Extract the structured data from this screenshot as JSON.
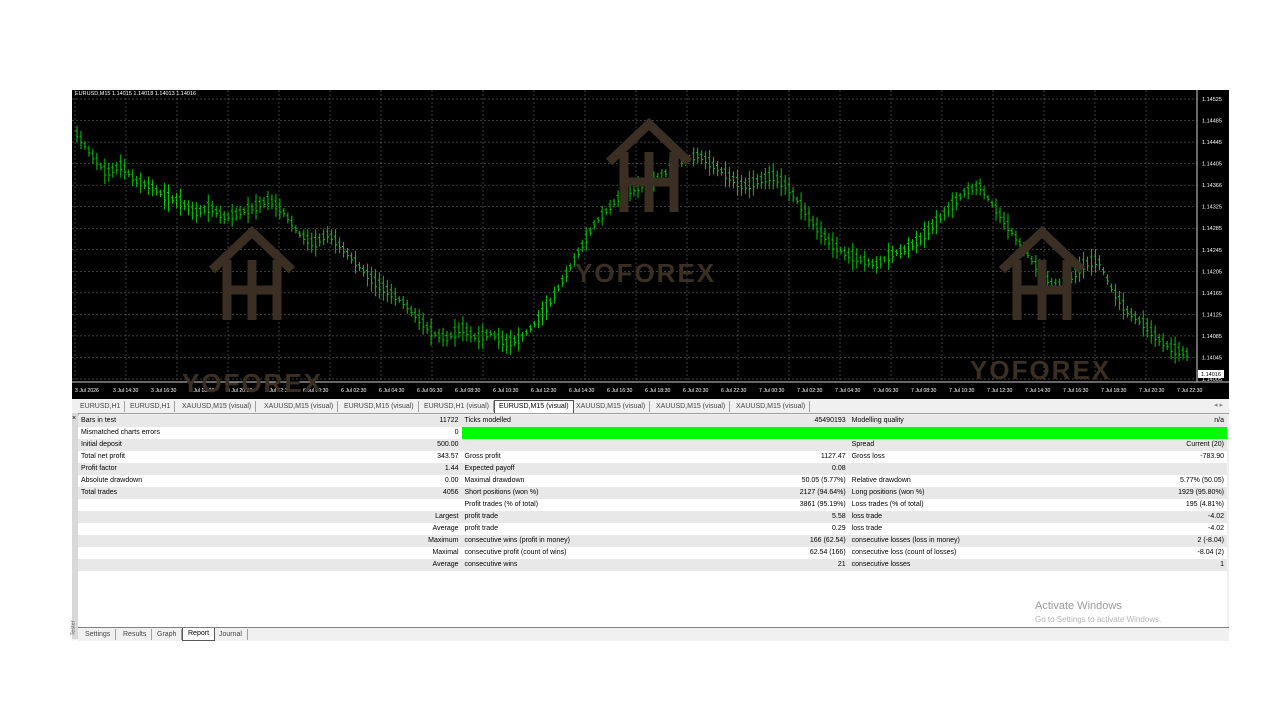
{
  "chart": {
    "header": "EURUSD,M15  1.14015 1.14018 1.14013 1.14016",
    "price_labels": [
      "1.14525",
      "1.14485",
      "1.14445",
      "1.14405",
      "1.14366",
      "1.14325",
      "1.14285",
      "1.14245",
      "1.14205",
      "1.14165",
      "1.14125",
      "1.14085",
      "1.14045",
      "1.14005"
    ],
    "current_price": "1.14016",
    "time_labels": [
      "3 Jul 2026",
      "3 Jul 14:30",
      "3 Jul 16:30",
      "3 Jul 18:30",
      "3 Jul 20:30",
      "3 Jul 22:30",
      "6 Jul 00:30",
      "6 Jul 02:30",
      "6 Jul 04:30",
      "6 Jul 06:30",
      "6 Jul 08:30",
      "6 Jul 10:30",
      "6 Jul 12:30",
      "6 Jul 14:30",
      "6 Jul 16:30",
      "6 Jul 18:30",
      "6 Jul 20:30",
      "6 Jul 22:30",
      "7 Jul 00:30",
      "7 Jul 02:30",
      "7 Jul 04:30",
      "7 Jul 06:30",
      "7 Jul 08:30",
      "7 Jul 10:30",
      "7 Jul 12:30",
      "7 Jul 14:30",
      "7 Jul 16:30",
      "7 Jul 18:30",
      "7 Jul 20:30",
      "7 Jul 22:30"
    ],
    "watermark": "YOFOREX",
    "bar_color": "#00c800",
    "price_path": [
      0.9,
      0.82,
      0.75,
      0.78,
      0.72,
      0.7,
      0.66,
      0.64,
      0.6,
      0.62,
      0.58,
      0.6,
      0.62,
      0.65,
      0.6,
      0.52,
      0.48,
      0.52,
      0.46,
      0.4,
      0.34,
      0.3,
      0.26,
      0.2,
      0.14,
      0.12,
      0.16,
      0.12,
      0.14,
      0.1,
      0.12,
      0.18,
      0.26,
      0.36,
      0.46,
      0.56,
      0.62,
      0.68,
      0.7,
      0.72,
      0.76,
      0.8,
      0.82,
      0.78,
      0.74,
      0.7,
      0.72,
      0.74,
      0.7,
      0.62,
      0.54,
      0.48,
      0.44,
      0.42,
      0.4,
      0.44,
      0.46,
      0.5,
      0.56,
      0.62,
      0.68,
      0.7,
      0.62,
      0.54,
      0.46,
      0.38,
      0.32,
      0.34,
      0.4,
      0.42,
      0.3,
      0.22,
      0.18,
      0.12,
      0.08,
      0.06
    ]
  },
  "chart_tabs": [
    "EURUSD,H1",
    "EURUSD,H1",
    "XAUUSD,M15 (visual)",
    "XAUUSD,M15 (visual)",
    "EURUSD,M15 (visual)",
    "EURUSD,H1 (visual)",
    "EURUSD,M15 (visual)",
    "XAUUSD,M15 (visual)",
    "XAUUSD,M15 (visual)",
    "XAUUSD,M15 (visual)"
  ],
  "active_tab_index": 6,
  "report": {
    "bars_in_test_label": "Bars in test",
    "bars_in_test": "11722",
    "ticks_modelled_label": "Ticks modelled",
    "ticks_modelled": "45490193",
    "modelling_quality_label": "Modelling quality",
    "modelling_quality": "n/a",
    "mismatched_label": "Mismatched charts errors",
    "mismatched": "0",
    "quality_bar_color": "#00ff00",
    "initial_deposit_label": "Initial deposit",
    "initial_deposit": "500.00",
    "spread_label": "Spread",
    "spread": "Current (20)",
    "net_profit_label": "Total net profit",
    "net_profit": "343.57",
    "gross_profit_label": "Gross profit",
    "gross_profit": "1127.47",
    "gross_loss_label": "Gross loss",
    "gross_loss": "-783.90",
    "profit_factor_label": "Profit factor",
    "profit_factor": "1.44",
    "expected_payoff_label": "Expected payoff",
    "expected_payoff": "0.08",
    "abs_drawdown_label": "Absolute drawdown",
    "abs_drawdown": "0.00",
    "max_drawdown_label": "Maximal drawdown",
    "max_drawdown": "50.05 (5.77%)",
    "rel_drawdown_label": "Relative drawdown",
    "rel_drawdown": "5.77% (50.05)",
    "total_trades_label": "Total trades",
    "total_trades": "4056",
    "short_label": "Short positions (won %)",
    "short": "2127 (94.64%)",
    "long_label": "Long positions (won %)",
    "long": "1929 (95.80%)",
    "profit_trades_label": "Profit trades (% of total)",
    "profit_trades": "3861 (95.19%)",
    "loss_trades_label": "Loss trades (% of total)",
    "loss_trades": "195 (4.81%)",
    "largest_label": "Largest",
    "largest_profit_label": "profit trade",
    "largest_profit": "5.58",
    "largest_loss_label": "loss trade",
    "largest_loss": "-4.02",
    "average_label": "Average",
    "average_profit_label": "profit trade",
    "average_profit": "0.29",
    "average_loss_label": "loss trade",
    "average_loss": "-4.02",
    "maximum_label": "Maximum",
    "max_cons_wins_label": "consecutive wins (profit in money)",
    "max_cons_wins": "166 (62.54)",
    "max_cons_losses_label": "consecutive losses (loss in money)",
    "max_cons_losses": "2 (-8.04)",
    "maximal_label": "Maximal",
    "maximal_cons_profit_label": "consecutive profit (count of wins)",
    "maximal_cons_profit": "62.54 (166)",
    "maximal_cons_loss_label": "consecutive loss (count of losses)",
    "maximal_cons_loss": "-8.04 (2)",
    "avg_label": "Average",
    "avg_cons_wins_label": "consecutive wins",
    "avg_cons_wins": "21",
    "avg_cons_losses_label": "consecutive losses",
    "avg_cons_losses": "1"
  },
  "bottom_tabs": [
    "Settings",
    "Results",
    "Graph",
    "Report",
    "Journal"
  ],
  "bottom_active_index": 3,
  "tester_label": "Tester",
  "close_glyph": "×",
  "tab_arrows": "◂ ▸",
  "activate": {
    "title": "Activate Windows",
    "subtitle": "Go to Settings to activate Windows."
  }
}
